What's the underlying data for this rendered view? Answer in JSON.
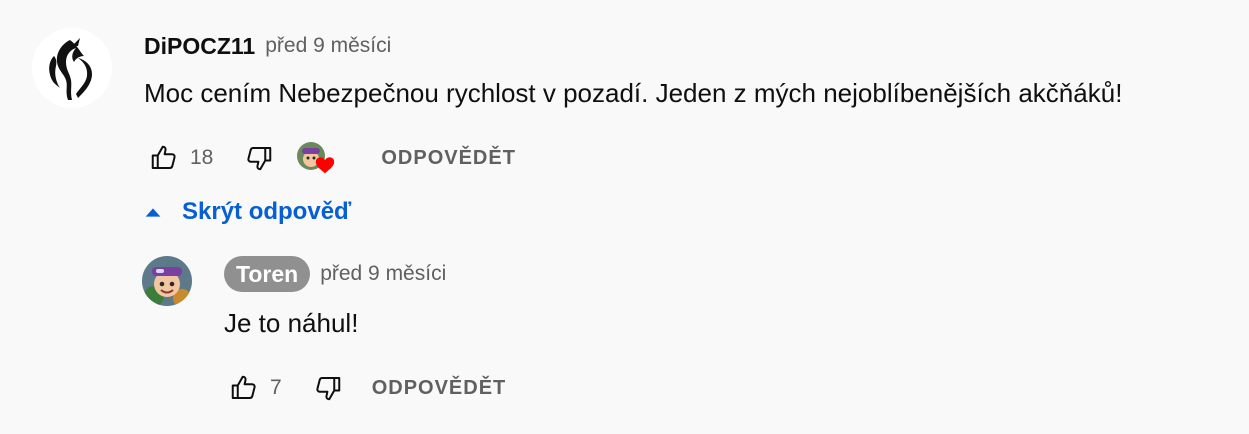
{
  "top_comment": {
    "author": "DiPOCZ11",
    "time": "před 9 měsíci",
    "text": "Moc cením Nebezpečnou rychlost v pozadí. Jeden z mých nejoblíbenějších akčňáků!",
    "likes": "18",
    "reply_label": "ODPOVĚDĚT",
    "avatar_icon": "dragon-logo-icon",
    "creator_heart_icon": "heart-icon"
  },
  "replies_toggle": {
    "label": "Skrýt odpověď",
    "icon": "caret-up-icon"
  },
  "reply_comment": {
    "author": "Toren",
    "time": "před 9 měsíci",
    "text": "Je to náhul!",
    "likes": "7",
    "reply_label": "ODPOVĚDĚT",
    "avatar_icon": "cartoon-avatar-icon"
  },
  "colors": {
    "background": "#f9f9f9",
    "link_blue": "#065fd4",
    "secondary_text": "#606060",
    "author_chip": "#909090",
    "heart_red": "#ff0000"
  }
}
